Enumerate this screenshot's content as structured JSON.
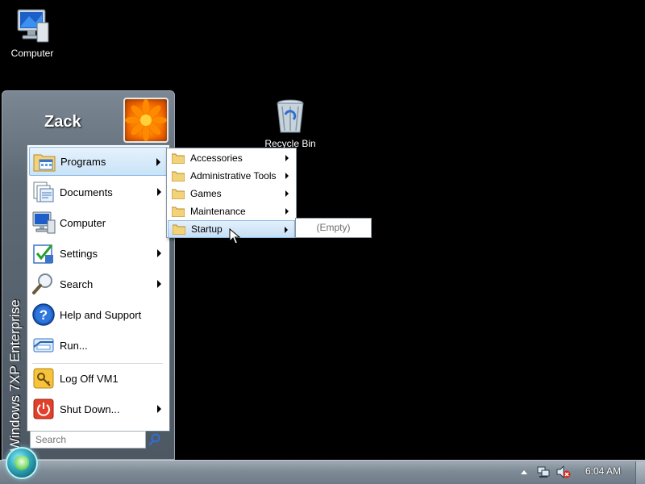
{
  "desktop": {
    "icons": [
      {
        "label": "Computer",
        "icon": "computer-icon"
      },
      {
        "label": "Recycle Bin",
        "icon": "recycle-bin-icon"
      }
    ]
  },
  "start_menu": {
    "user_name": "Zack",
    "side_text": "Windows 7XP Enterprise",
    "items": [
      {
        "label": "Programs",
        "icon": "programs-icon",
        "has_submenu": true,
        "active": true
      },
      {
        "label": "Documents",
        "icon": "documents-icon",
        "has_submenu": true
      },
      {
        "label": "Computer",
        "icon": "computer-icon",
        "has_submenu": false
      },
      {
        "label": "Settings",
        "icon": "settings-icon",
        "has_submenu": true
      },
      {
        "label": "Search",
        "icon": "search-icon",
        "has_submenu": true
      },
      {
        "label": "Help and Support",
        "icon": "help-icon",
        "has_submenu": false
      },
      {
        "label": "Run...",
        "icon": "run-icon",
        "has_submenu": false
      },
      {
        "label": "Log Off VM1",
        "icon": "logoff-icon",
        "has_submenu": false
      },
      {
        "label": "Shut Down...",
        "icon": "shutdown-icon",
        "has_submenu": true
      }
    ],
    "search_placeholder": "Search"
  },
  "programs_submenu": {
    "items": [
      {
        "label": "Accessories"
      },
      {
        "label": "Administrative Tools"
      },
      {
        "label": "Games"
      },
      {
        "label": "Maintenance"
      },
      {
        "label": "Startup",
        "active": true
      }
    ]
  },
  "startup_submenu": {
    "empty_label": "(Empty)"
  },
  "taskbar": {
    "clock": "6:04 AM"
  },
  "colors": {
    "accent": "#8dbbe4",
    "taskbar": "#7f8b96",
    "start_menu_bg": "#5d6a75"
  }
}
